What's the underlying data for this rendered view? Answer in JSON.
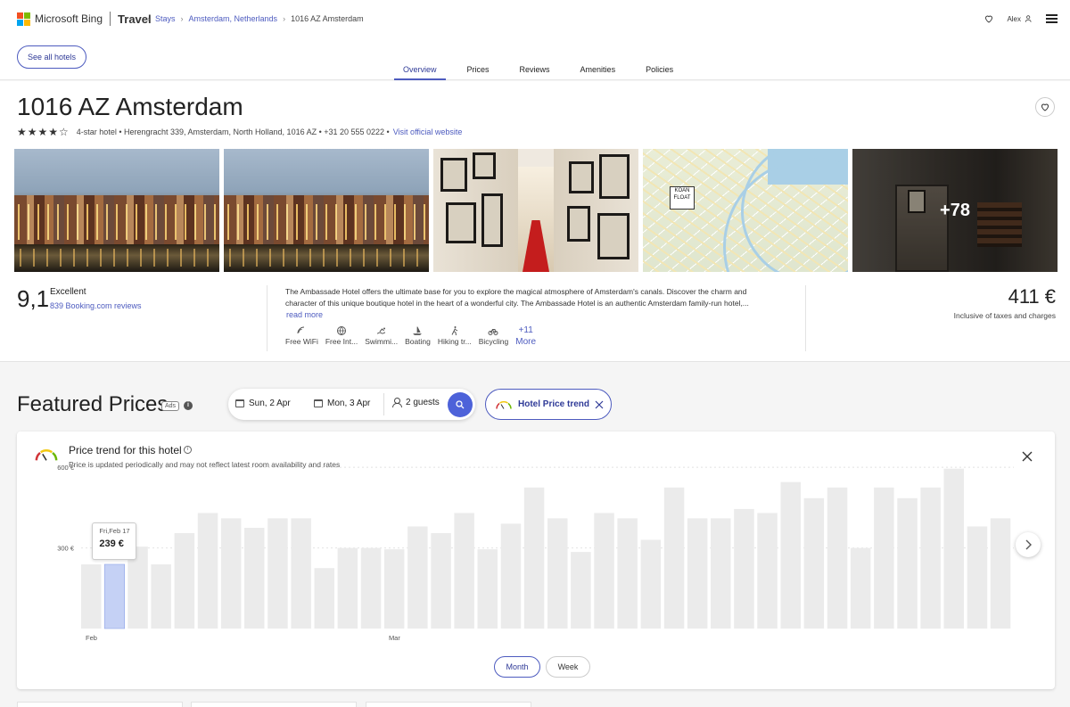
{
  "header": {
    "brand": "Microsoft Bing",
    "section": "Travel",
    "breadcrumbs": [
      "Stays",
      "Amsterdam, Netherlands",
      "1016 AZ Amsterdam"
    ],
    "user": "Alex",
    "see_all": "See all hotels",
    "tabs": [
      "Overview",
      "Prices",
      "Reviews",
      "Amenities",
      "Policies"
    ],
    "active_tab": "Overview"
  },
  "hotel": {
    "title": "1016 AZ Amsterdam",
    "stars_text": "★★★★☆",
    "star_rating": 4,
    "meta_text": "4-star hotel • Herengracht 339, Amsterdam, North Holland, 1016 AZ • +31 20 555 0222 •",
    "website_link": "Visit official website",
    "photos_more": "+78",
    "map_sign": "KOAN FLOAT",
    "rating_score": "9,1",
    "rating_label": "Excellent",
    "rating_reviews": "839 Booking.com reviews",
    "description": "The Ambassade Hotel offers the ultimate base for you to explore the magical atmosphere of Amsterdam's canals. Discover the charm and character of this unique boutique hotel in the heart of a wonderful city. The Ambassade Hotel is an authentic Amsterdam family-run hotel,...",
    "read_more": "read more",
    "amenities": [
      {
        "icon": "wifi-icon",
        "label": "Free WiFi"
      },
      {
        "icon": "globe-icon",
        "label": "Free Int..."
      },
      {
        "icon": "swimming-icon",
        "label": "Swimmi..."
      },
      {
        "icon": "sailboat-icon",
        "label": "Boating"
      },
      {
        "icon": "hiking-icon",
        "label": "Hiking tr..."
      },
      {
        "icon": "bicycle-icon",
        "label": "Bicycling"
      }
    ],
    "amenities_more_count": "+11",
    "amenities_more_label": "More",
    "price": "411 €",
    "price_note": "Inclusive of taxes and charges"
  },
  "featured": {
    "title": "Featured Prices",
    "ads": "Ads",
    "info": "i",
    "checkin": "Sun, 2 Apr",
    "checkout": "Mon, 3 Apr",
    "guests": "2 guests",
    "trend_chip": "Hotel Price trend"
  },
  "trend": {
    "title": "Price trend for this hotel",
    "subtitle": "Price is updated periodically and may not reflect latest room availability and rates",
    "tooltip_date": "Fri,Feb 17",
    "tooltip_value": "239 €",
    "toggle_month": "Month",
    "toggle_week": "Week"
  },
  "colors": {
    "accent": "#4d5bbf",
    "bar": "#ebebeb",
    "bar_selected": "#c5d1f5"
  },
  "chart_data": {
    "type": "bar",
    "y_unit": "€",
    "ylim": [
      0,
      700
    ],
    "y_ticks": [
      {
        "value": 300,
        "label": "300 €"
      },
      {
        "value": 600,
        "label": "600 €"
      }
    ],
    "x_tick_labels": [
      {
        "index": 0,
        "label": "Feb"
      },
      {
        "index": 13,
        "label": "Mar"
      }
    ],
    "selected_index": 1,
    "values": [
      239,
      239,
      305,
      239,
      355,
      430,
      410,
      375,
      410,
      410,
      225,
      300,
      300,
      295,
      380,
      355,
      430,
      295,
      390,
      525,
      410,
      285,
      430,
      410,
      330,
      525,
      410,
      410,
      445,
      430,
      545,
      485,
      525,
      300,
      525,
      485,
      525,
      595,
      380,
      410
    ]
  }
}
